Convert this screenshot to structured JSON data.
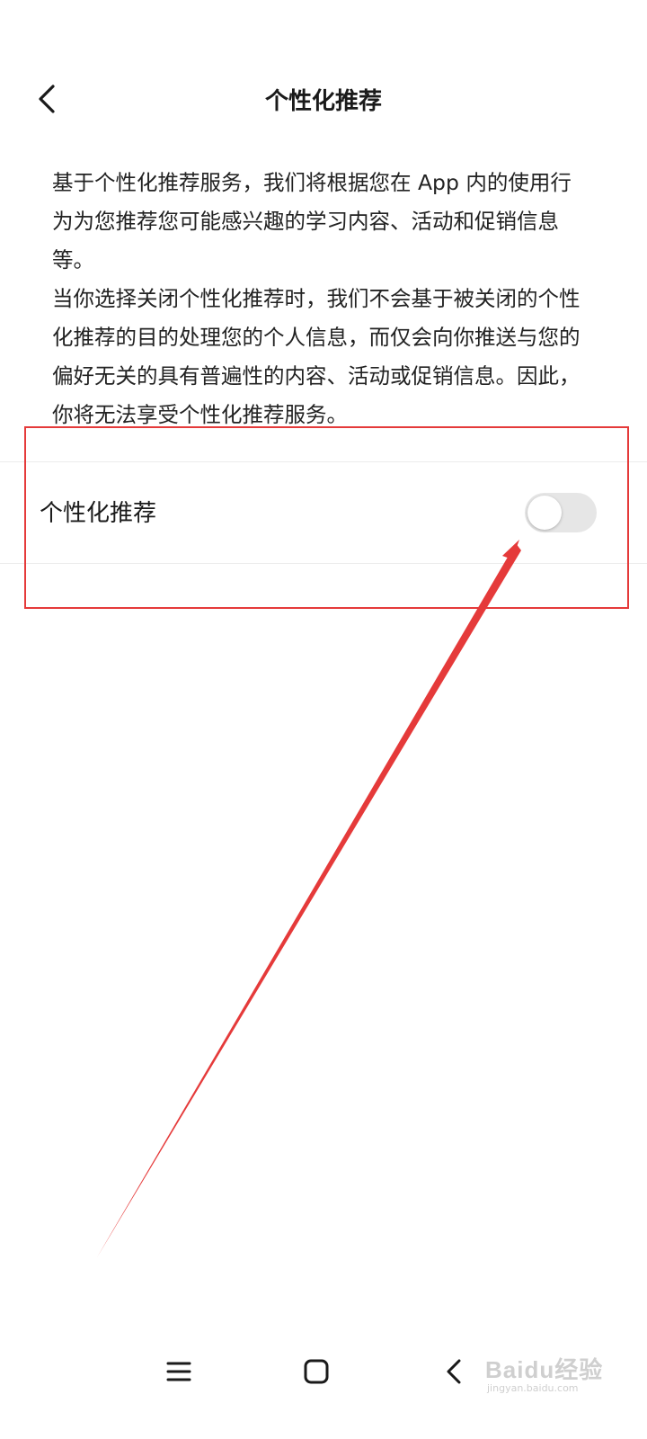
{
  "header": {
    "title": "个性化推荐",
    "back_icon": "chevron-left-icon"
  },
  "description": {
    "paragraph1": "基于个性化推荐服务，我们将根据您在 App 内的使用行为为您推荐您可能感兴趣的学习内容、活动和促销信息等。",
    "paragraph2": "当你选择关闭个性化推荐时，我们不会基于被关闭的个性化推荐的目的处理您的个人信息，而仅会向你推送与您的偏好无关的具有普遍性的内容、活动或促销信息。因此，你将无法享受个性化推荐服务。"
  },
  "setting": {
    "label": "个性化推荐",
    "enabled": false
  },
  "annotation": {
    "color": "#e53a3a"
  },
  "nav_bar": {
    "icons": [
      "menu-icon",
      "home-square-icon",
      "back-chevron-icon"
    ]
  },
  "watermark": {
    "text": "Baidu经验",
    "subtext": "jingyan.baidu.com"
  }
}
